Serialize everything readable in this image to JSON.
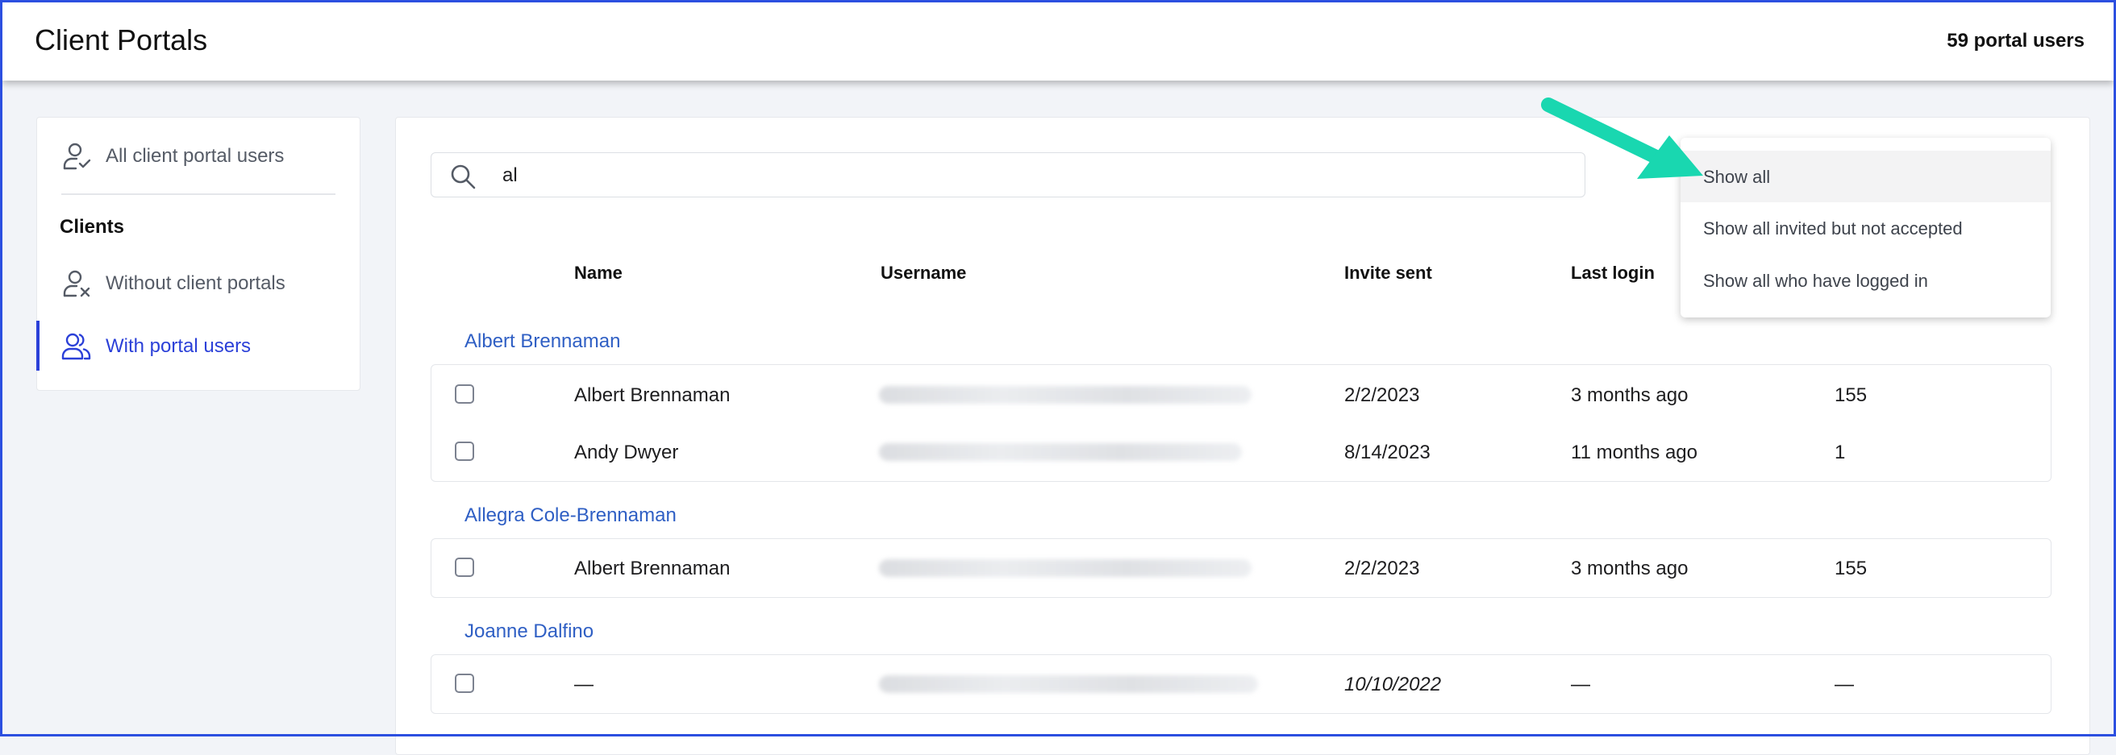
{
  "header": {
    "title": "Client Portals",
    "count_label": "59 portal users"
  },
  "sidebar": {
    "all_users_label": "All client portal users",
    "section_heading": "Clients",
    "without_label": "Without client portals",
    "with_label": "With portal users"
  },
  "search": {
    "value": "al"
  },
  "table": {
    "headers": {
      "name": "Name",
      "username": "Username",
      "invite_sent": "Invite sent",
      "last_login": "Last login"
    },
    "groups": [
      {
        "client": "Albert Brennaman",
        "rows": [
          {
            "name": "Albert Brennaman",
            "invite_sent": "2/2/2023",
            "last_login": "3 months ago",
            "count": "155"
          },
          {
            "name": "Andy Dwyer",
            "invite_sent": "8/14/2023",
            "last_login": "11 months ago",
            "count": "1"
          }
        ]
      },
      {
        "client": "Allegra Cole-Brennaman",
        "rows": [
          {
            "name": "Albert Brennaman",
            "invite_sent": "2/2/2023",
            "last_login": "3 months ago",
            "count": "155"
          }
        ]
      },
      {
        "client": "Joanne Dalfino",
        "rows": [
          {
            "name": "—",
            "invite_sent": "10/10/2022",
            "last_login": "—",
            "count": "—"
          }
        ]
      }
    ]
  },
  "filter_dropdown": {
    "options": [
      "Show all",
      "Show all invited but not accepted",
      "Show all who have logged in"
    ],
    "selected": "Show all"
  },
  "colors": {
    "accent": "#2b40d8",
    "link": "#2f5fc4",
    "arrow": "#19d7b0"
  },
  "icons": [
    "user-check-icon",
    "user-x-icon",
    "users-icon",
    "search-icon",
    "arrow-annotation-icon"
  ]
}
